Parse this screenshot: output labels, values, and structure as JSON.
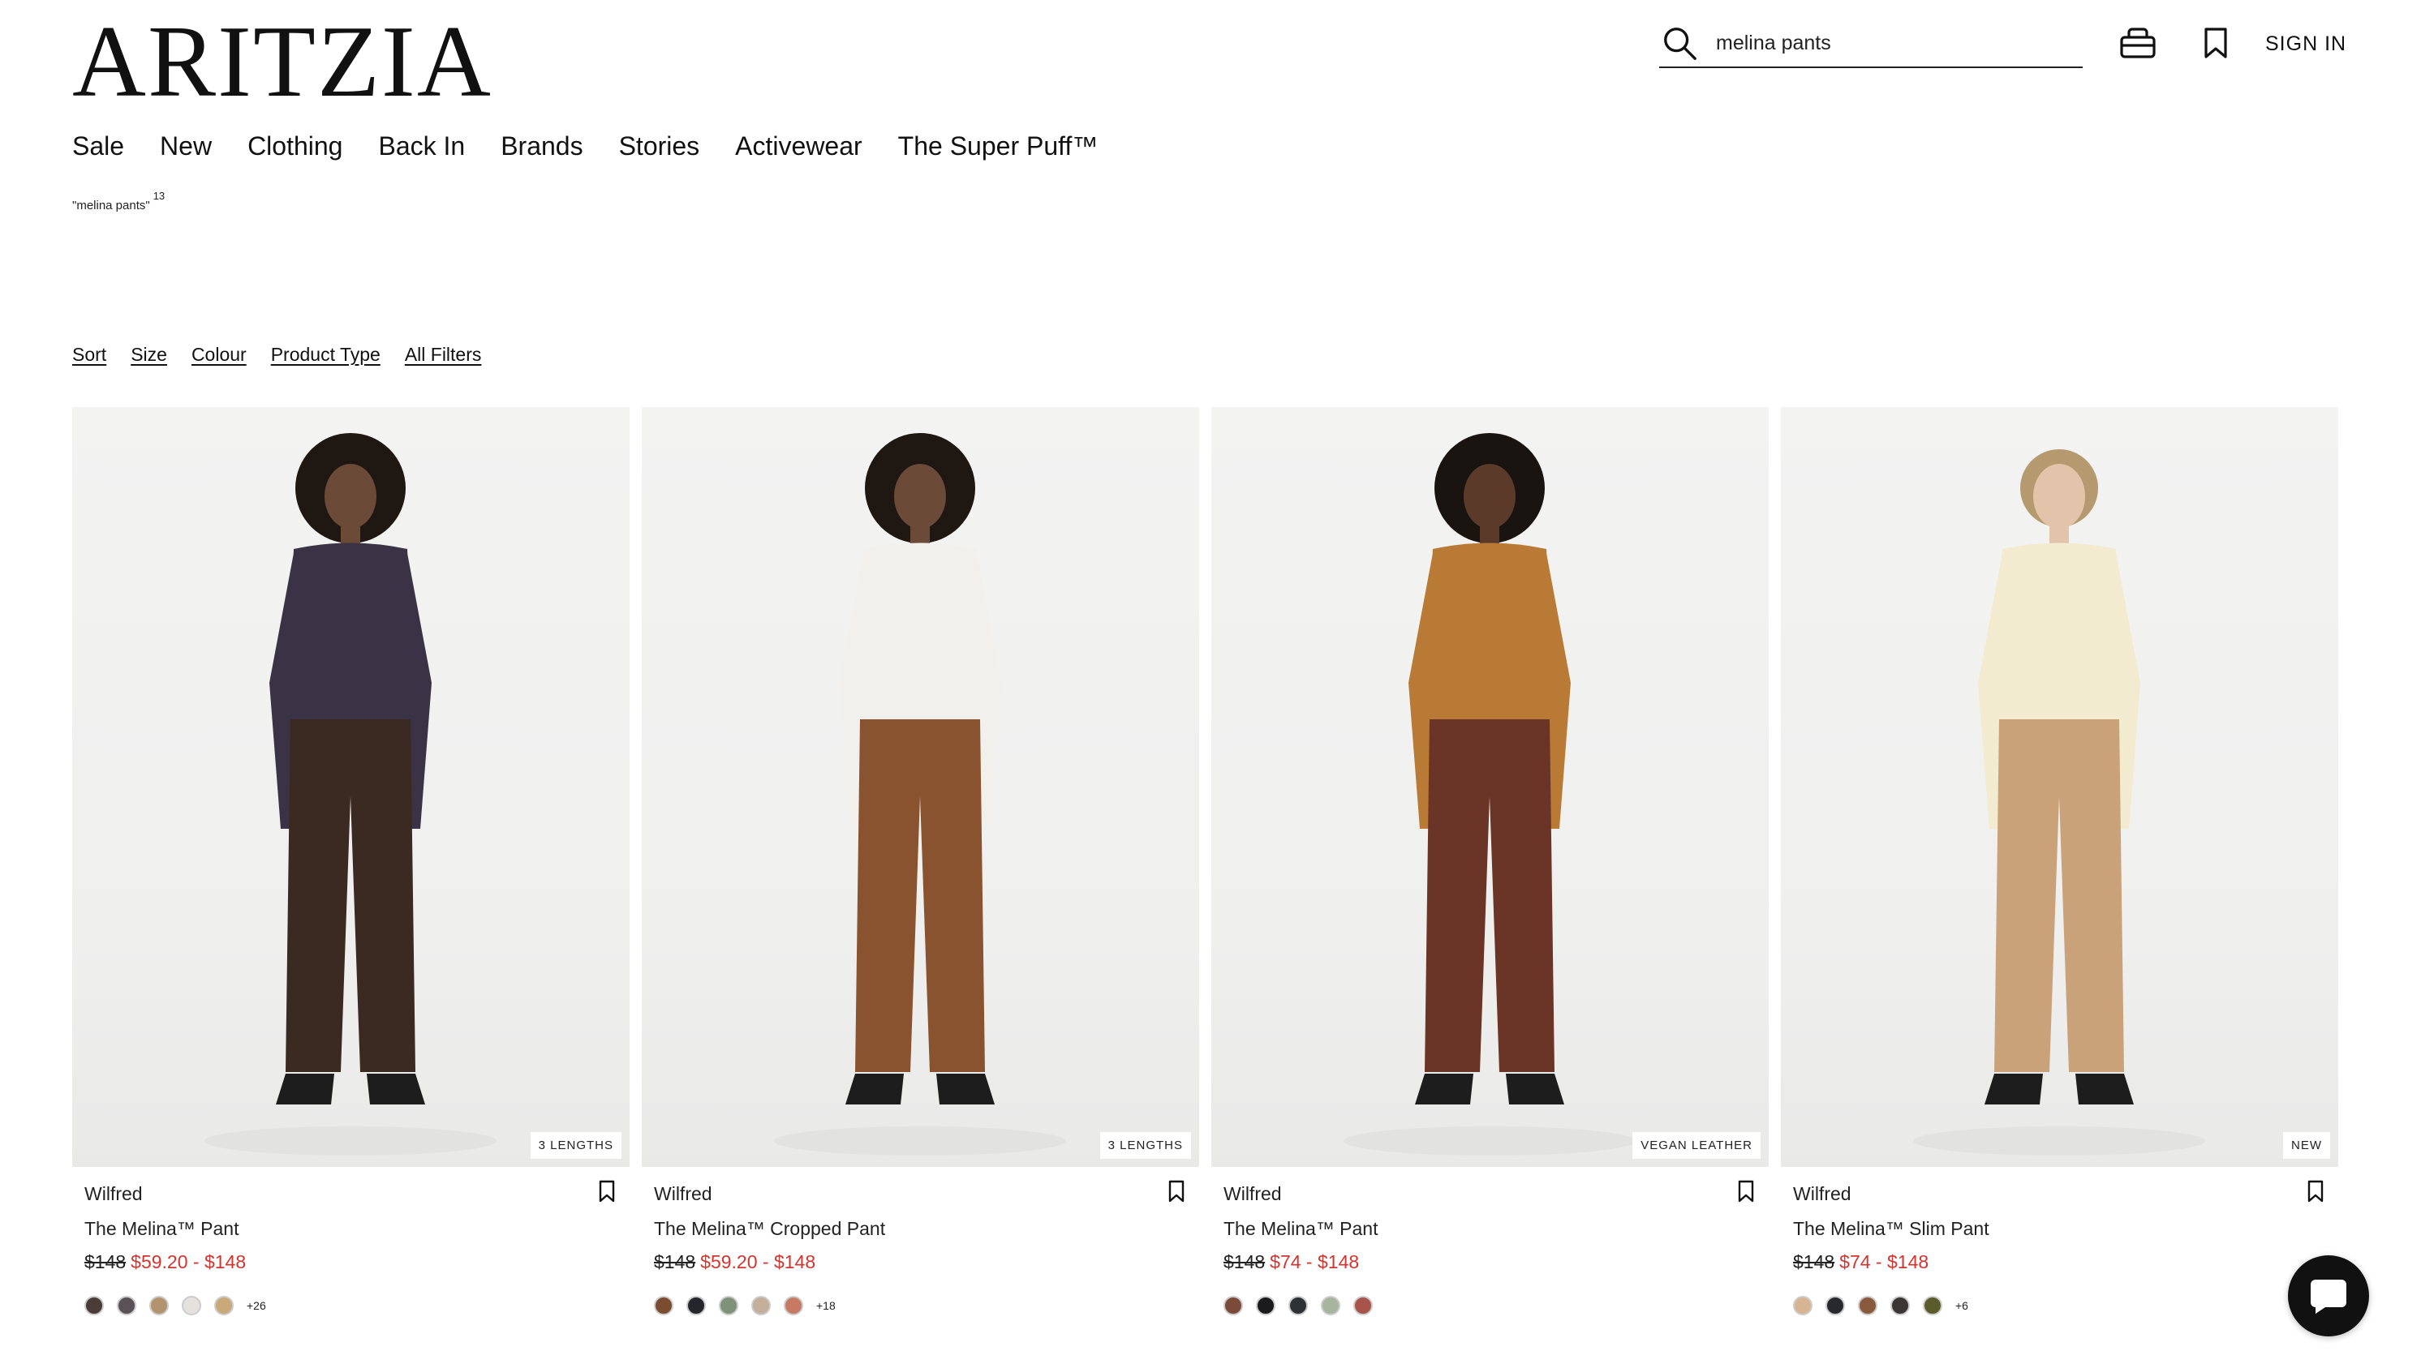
{
  "brand_logo": "ARITZIA",
  "header": {
    "search_value": "melina pants",
    "search_placeholder": "Search",
    "sign_in": "SIGN IN",
    "icons": [
      "search-icon",
      "bag-icon",
      "bookmark-icon"
    ]
  },
  "nav": {
    "items": [
      "Sale",
      "New",
      "Clothing",
      "Back In",
      "Brands",
      "Stories",
      "Activewear",
      "The Super Puff™"
    ]
  },
  "results": {
    "query": "\"melina pants\"",
    "count": "13"
  },
  "filters": [
    "Sort",
    "Size",
    "Colour",
    "Product Type",
    "All Filters"
  ],
  "colors": {
    "sale_price": "#d3352e",
    "text": "#1a1a1a"
  },
  "products": [
    {
      "badge": "3 LENGTHS",
      "brand": "Wilfred",
      "name": "The Melina™ Pant",
      "original_price": "$148",
      "sale_price": "$59.20 - $148",
      "swatches": [
        "#4a3c36",
        "#5a5256",
        "#b3936d",
        "#e5e1dc",
        "#c9a97a"
      ],
      "more_colors": "+26",
      "top_color": "#3a3245",
      "pant_color": "#3b2a22",
      "skin": "#6b4a38",
      "hair": "#1e1712"
    },
    {
      "badge": "3 LENGTHS",
      "brand": "Wilfred",
      "name": "The Melina™ Cropped Pant",
      "original_price": "$148",
      "sale_price": "$59.20 - $148",
      "swatches": [
        "#7a4d33",
        "#24262b",
        "#7f9279",
        "#c4b09a",
        "#c77a63"
      ],
      "more_colors": "+18",
      "top_color": "#f1f0ec",
      "pant_color": "#8a5330",
      "skin": "#6b4a38",
      "hair": "#1e1712"
    },
    {
      "badge": "VEGAN LEATHER",
      "brand": "Wilfred",
      "name": "The Melina™ Pant",
      "original_price": "$148",
      "sale_price": "$74 - $148",
      "swatches": [
        "#7a4a3a",
        "#1b1b1d",
        "#2f3235",
        "#a7b59f",
        "#a8544a"
      ],
      "more_colors": "",
      "top_color": "#b97a35",
      "pant_color": "#6a3526",
      "skin": "#5b3a2a",
      "hair": "#1a1410"
    },
    {
      "badge": "NEW",
      "brand": "Wilfred",
      "name": "The Melina™ Slim Pant",
      "original_price": "$148",
      "sale_price": "$74 - $148",
      "swatches": [
        "#d8b592",
        "#27292d",
        "#8a5a3e",
        "#3b3634",
        "#5a5c2c"
      ],
      "more_colors": "+6",
      "top_color": "#f3ebcf",
      "pant_color": "#c9a27a",
      "skin": "#e2c4aa",
      "hair": "#b59a70"
    }
  ]
}
